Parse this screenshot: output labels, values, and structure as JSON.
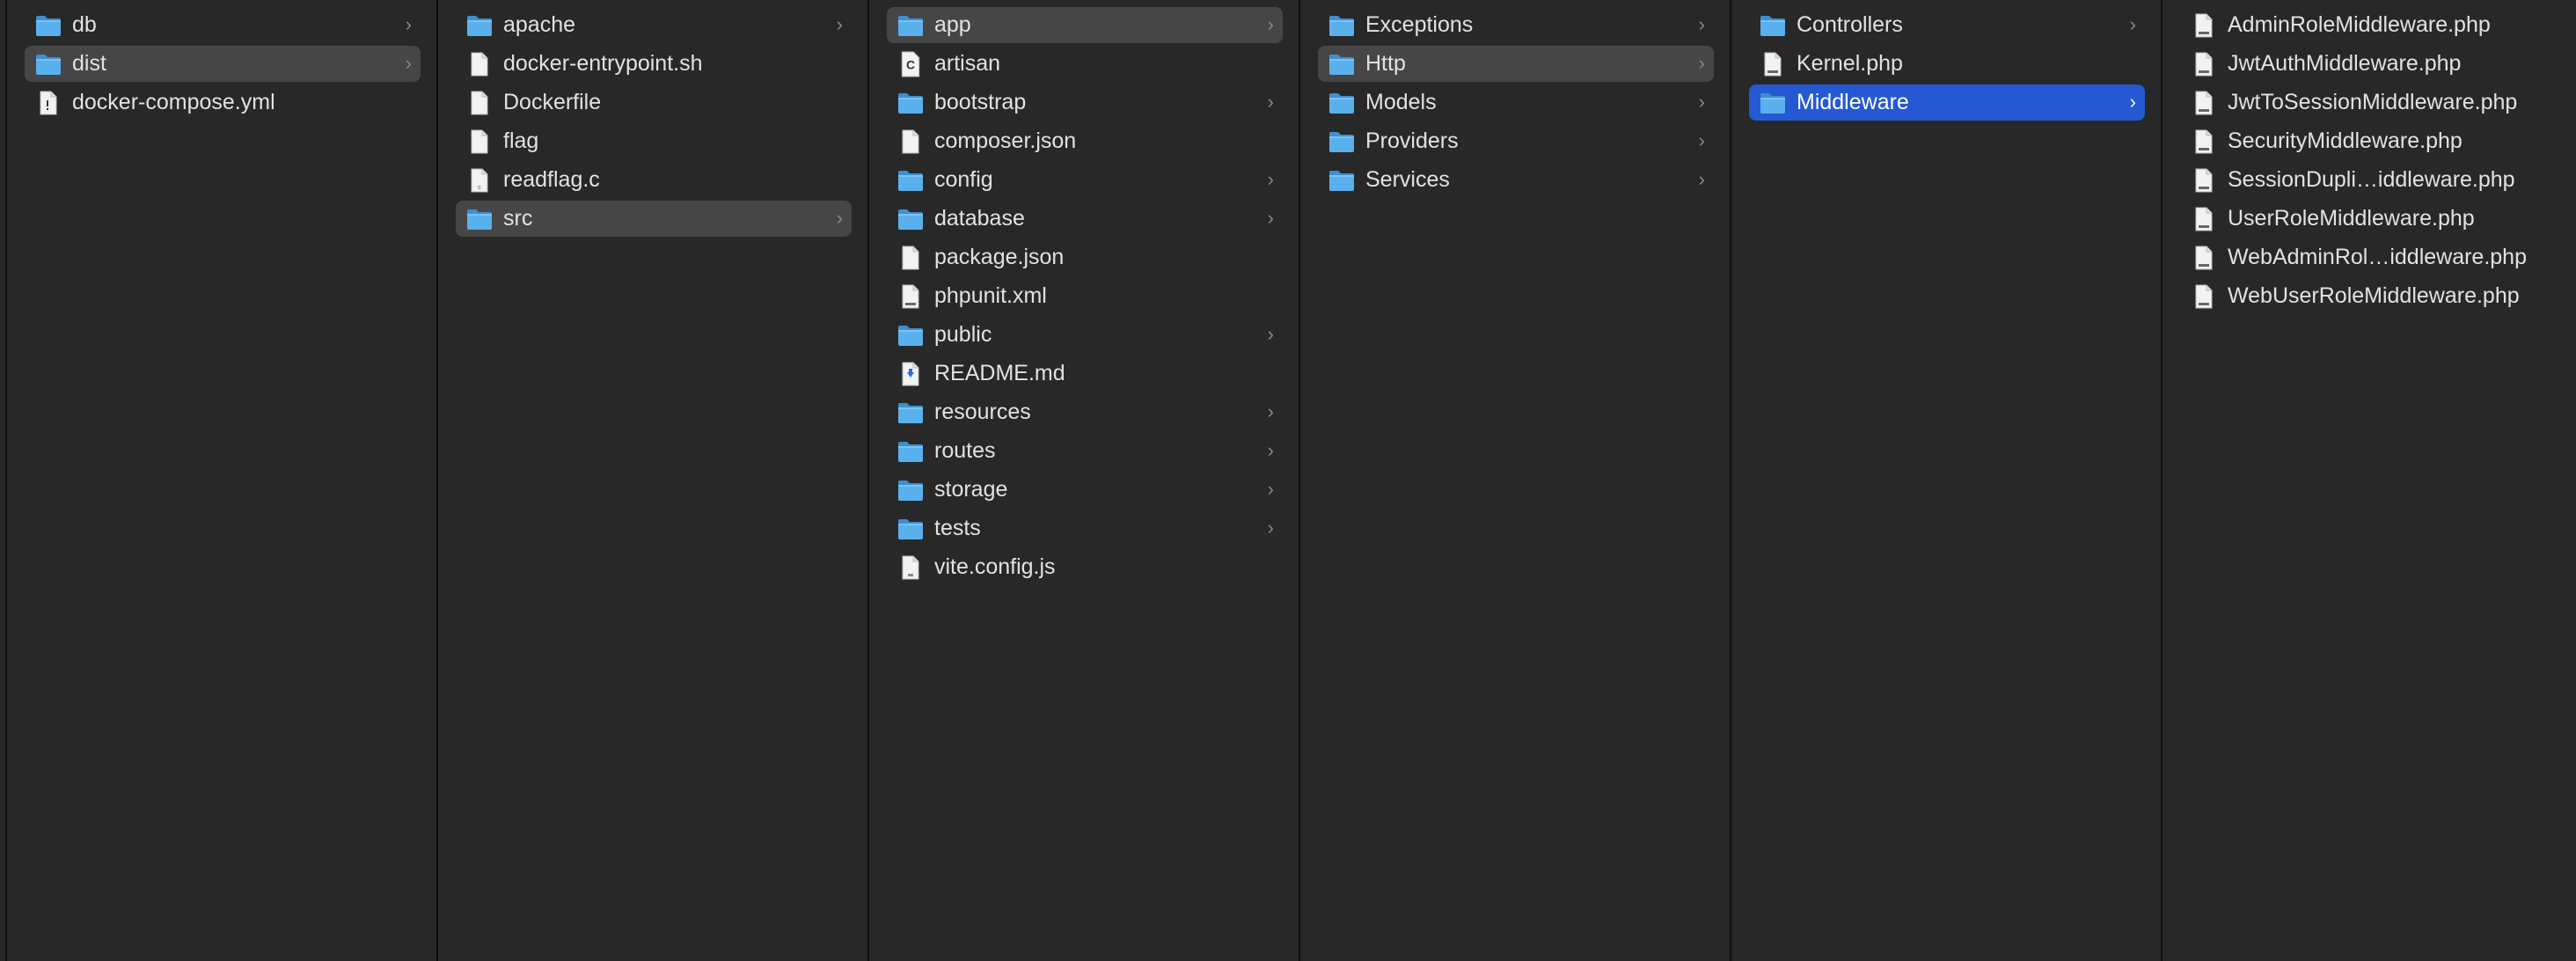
{
  "columns": [
    {
      "items": [
        {
          "label": "db",
          "type": "folder",
          "icon": "folder-icon",
          "state": ""
        },
        {
          "label": "dist",
          "type": "folder",
          "icon": "folder-icon",
          "state": "sel-gray"
        },
        {
          "label": "docker-compose.yml",
          "type": "file",
          "icon": "yaml-file-icon",
          "state": ""
        }
      ]
    },
    {
      "items": [
        {
          "label": "apache",
          "type": "folder",
          "icon": "folder-icon",
          "state": ""
        },
        {
          "label": "docker-entrypoint.sh",
          "type": "file",
          "icon": "document-icon",
          "state": ""
        },
        {
          "label": "Dockerfile",
          "type": "file",
          "icon": "document-icon",
          "state": ""
        },
        {
          "label": "flag",
          "type": "file",
          "icon": "document-icon",
          "state": ""
        },
        {
          "label": "readflag.c",
          "type": "file",
          "icon": "c-file-icon",
          "state": ""
        },
        {
          "label": "src",
          "type": "folder",
          "icon": "folder-icon",
          "state": "sel-gray"
        }
      ]
    },
    {
      "items": [
        {
          "label": "app",
          "type": "folder",
          "icon": "folder-icon",
          "state": "sel-gray"
        },
        {
          "label": "artisan",
          "type": "file",
          "icon": "executable-icon",
          "state": ""
        },
        {
          "label": "bootstrap",
          "type": "folder",
          "icon": "folder-icon",
          "state": ""
        },
        {
          "label": "composer.json",
          "type": "file",
          "icon": "document-icon",
          "state": ""
        },
        {
          "label": "config",
          "type": "folder",
          "icon": "folder-icon",
          "state": ""
        },
        {
          "label": "database",
          "type": "folder",
          "icon": "folder-icon",
          "state": ""
        },
        {
          "label": "package.json",
          "type": "file",
          "icon": "document-icon",
          "state": ""
        },
        {
          "label": "phpunit.xml",
          "type": "file",
          "icon": "code-file-icon",
          "state": ""
        },
        {
          "label": "public",
          "type": "folder",
          "icon": "folder-icon",
          "state": ""
        },
        {
          "label": "README.md",
          "type": "file",
          "icon": "markdown-file-icon",
          "state": ""
        },
        {
          "label": "resources",
          "type": "folder",
          "icon": "folder-icon",
          "state": ""
        },
        {
          "label": "routes",
          "type": "folder",
          "icon": "folder-icon",
          "state": ""
        },
        {
          "label": "storage",
          "type": "folder",
          "icon": "folder-icon",
          "state": ""
        },
        {
          "label": "tests",
          "type": "folder",
          "icon": "folder-icon",
          "state": ""
        },
        {
          "label": "vite.config.js",
          "type": "file",
          "icon": "js-file-icon",
          "state": ""
        }
      ]
    },
    {
      "items": [
        {
          "label": "Exceptions",
          "type": "folder",
          "icon": "folder-icon",
          "state": ""
        },
        {
          "label": "Http",
          "type": "folder",
          "icon": "folder-icon",
          "state": "sel-gray"
        },
        {
          "label": "Models",
          "type": "folder",
          "icon": "folder-icon",
          "state": ""
        },
        {
          "label": "Providers",
          "type": "folder",
          "icon": "folder-icon",
          "state": ""
        },
        {
          "label": "Services",
          "type": "folder",
          "icon": "folder-icon",
          "state": ""
        }
      ]
    },
    {
      "items": [
        {
          "label": "Controllers",
          "type": "folder",
          "icon": "folder-icon",
          "state": ""
        },
        {
          "label": "Kernel.php",
          "type": "file",
          "icon": "php-file-icon",
          "state": ""
        },
        {
          "label": "Middleware",
          "type": "folder",
          "icon": "folder-icon",
          "state": "sel-blue"
        }
      ]
    },
    {
      "items": [
        {
          "label": "AdminRoleMiddleware.php",
          "type": "file",
          "icon": "php-file-icon",
          "state": ""
        },
        {
          "label": "JwtAuthMiddleware.php",
          "type": "file",
          "icon": "php-file-icon",
          "state": ""
        },
        {
          "label": "JwtToSessionMiddleware.php",
          "type": "file",
          "icon": "php-file-icon",
          "state": ""
        },
        {
          "label": "SecurityMiddleware.php",
          "type": "file",
          "icon": "php-file-icon",
          "state": ""
        },
        {
          "label": "SessionDupli…iddleware.php",
          "type": "file",
          "icon": "php-file-icon",
          "state": ""
        },
        {
          "label": "UserRoleMiddleware.php",
          "type": "file",
          "icon": "php-file-icon",
          "state": ""
        },
        {
          "label": "WebAdminRol…iddleware.php",
          "type": "file",
          "icon": "php-file-icon",
          "state": ""
        },
        {
          "label": "WebUserRoleMiddleware.php",
          "type": "file",
          "icon": "php-file-icon",
          "state": ""
        }
      ]
    }
  ],
  "chevron_glyph": "›",
  "colors": {
    "background": "#282828",
    "selected_gray": "#464646",
    "selected_blue": "#2459d3",
    "folder": "#5ab0ec",
    "file": "#f2f2f2"
  }
}
